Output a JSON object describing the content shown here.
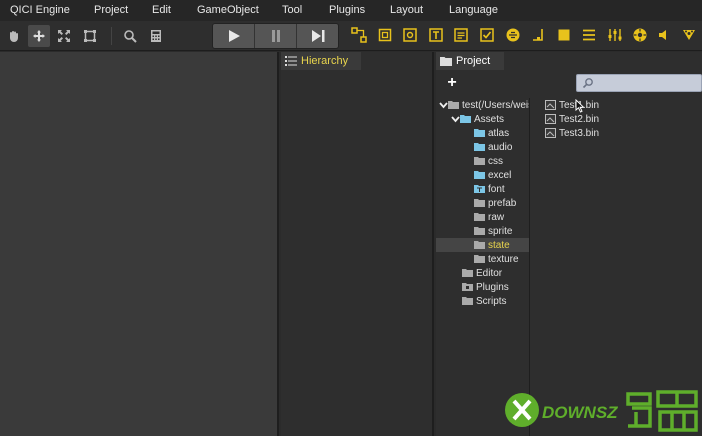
{
  "menu": {
    "items": [
      "QICI Engine",
      "Project",
      "Edit",
      "GameObject",
      "Tool",
      "Plugins",
      "Layout",
      "Language"
    ]
  },
  "toolbar": {
    "tool_icons": [
      "hand-tool-icon",
      "move-tool-icon",
      "scale-tool-icon",
      "rect-tool-icon",
      "zoom-icon",
      "calculator-icon"
    ],
    "play_controls": [
      "play-icon",
      "pause-icon",
      "step-icon"
    ],
    "create_icons": [
      "node-icon",
      "empty-icon",
      "image-icon",
      "text-icon",
      "ui-text-icon",
      "toggle-icon",
      "sprite-icon",
      "tilemap-icon",
      "square-icon",
      "list-icon",
      "sliders-icon",
      "gear-icon",
      "sound-icon",
      "emitter-icon"
    ],
    "accent_color": "#e8c21c"
  },
  "hierarchy": {
    "tab_label": "Hierarchy"
  },
  "project": {
    "tab_label": "Project",
    "add_label": "+",
    "search_placeholder": "",
    "tree": [
      {
        "label": "test(/Users/weis",
        "level": 0,
        "expanded": true
      },
      {
        "label": "Assets",
        "level": 1,
        "expanded": true
      },
      {
        "label": "atlas",
        "level": 2
      },
      {
        "label": "audio",
        "level": 2
      },
      {
        "label": "css",
        "level": 2
      },
      {
        "label": "excel",
        "level": 2
      },
      {
        "label": "font",
        "level": 2
      },
      {
        "label": "prefab",
        "level": 2
      },
      {
        "label": "raw",
        "level": 2
      },
      {
        "label": "sprite",
        "level": 2
      },
      {
        "label": "state",
        "level": 2,
        "selected": true
      },
      {
        "label": "texture",
        "level": 2
      },
      {
        "label": "Editor",
        "level": 1
      },
      {
        "label": "Plugins",
        "level": 1
      },
      {
        "label": "Scripts",
        "level": 1
      }
    ],
    "files": [
      "Test1.bin",
      "Test2.bin",
      "Test3.bin"
    ]
  },
  "watermark": {
    "text": "DOWNSZ"
  }
}
